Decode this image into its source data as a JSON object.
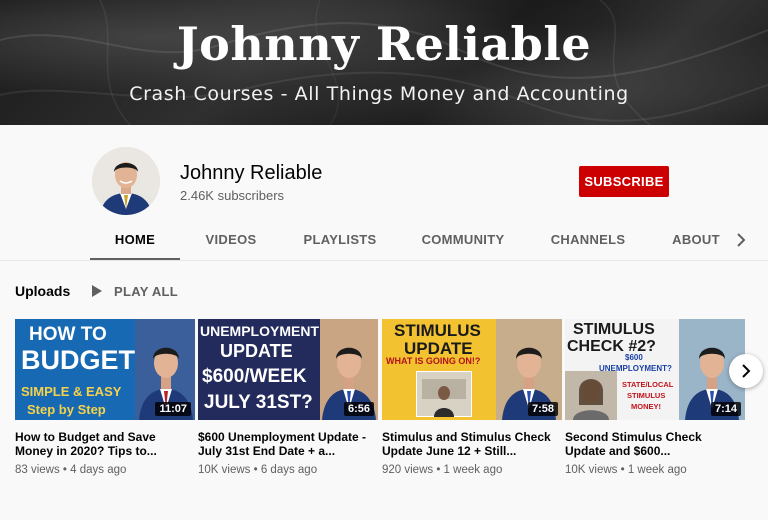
{
  "banner": {
    "title": "Johnny Reliable",
    "subtitle": "Crash Courses - All Things Money and Accounting"
  },
  "channel": {
    "name": "Johnny Reliable",
    "subscribers": "2.46K subscribers",
    "subscribe_label": "SUBSCRIBE",
    "avatar_icon": "person-avatar"
  },
  "tabs": [
    {
      "label": "HOME",
      "active": true
    },
    {
      "label": "VIDEOS",
      "active": false
    },
    {
      "label": "PLAYLISTS",
      "active": false
    },
    {
      "label": "COMMUNITY",
      "active": false
    },
    {
      "label": "CHANNELS",
      "active": false
    },
    {
      "label": "ABOUT",
      "active": false
    }
  ],
  "tabs_more_icon": "chevron-right-icon",
  "section": {
    "title": "Uploads",
    "play_all_label": "PLAY ALL"
  },
  "videos": [
    {
      "title": "How to Budget and Save Money in 2020? Tips to...",
      "meta": "83 views • 4 days ago",
      "duration": "11:07",
      "thumb_text": [
        "HOW TO",
        "BUDGET",
        "SIMPLE & EASY",
        "Step by Step"
      ]
    },
    {
      "title": "$600 Unemployment Update - July 31st End Date + a...",
      "meta": "10K views • 6 days ago",
      "duration": "6:56",
      "thumb_text": [
        "UNEMPLOYMENT",
        "UPDATE",
        "$600/WEEK",
        "JULY 31ST?"
      ]
    },
    {
      "title": "Stimulus and Stimulus Check Update June 12 + Still...",
      "meta": "920 views • 1 week ago",
      "duration": "7:58",
      "thumb_text": [
        "STIMULUS",
        "UPDATE",
        "WHAT IS GOING ON!?"
      ]
    },
    {
      "title": "Second Stimulus Check Update and $600...",
      "meta": "10K views • 1 week ago",
      "duration": "7:14",
      "thumb_text": [
        "STIMULUS",
        "CHECK #2?",
        "$600",
        "UNEMPLOYMENT?",
        "STATE/LOCAL",
        "STIMULUS",
        "MONEY!"
      ]
    }
  ],
  "colors": {
    "subscribe_red": "#cc0000",
    "budget_blue": "#1769b3",
    "unemployment_navy": "#232a5c",
    "stimulus_yellow": "#f2c230",
    "text_secondary": "#606060"
  }
}
